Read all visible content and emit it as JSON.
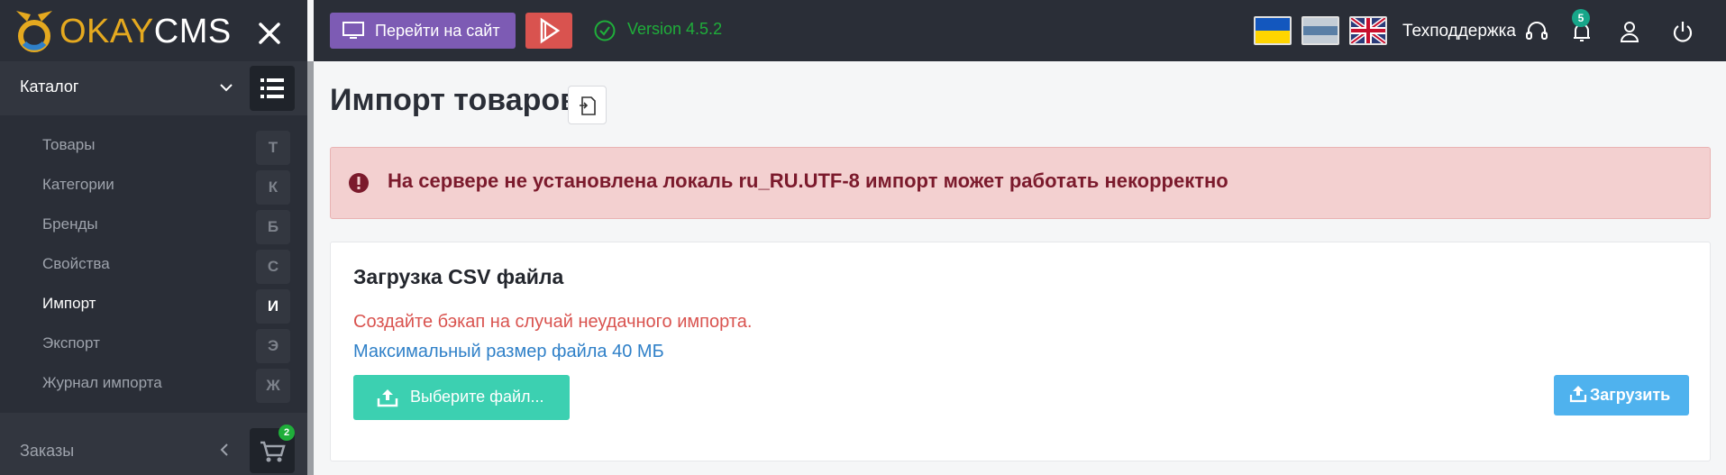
{
  "brand": {
    "name_part1": "OKAY",
    "name_part2": "CMS"
  },
  "sidebar": {
    "section_title": "Каталог",
    "items": [
      {
        "label": "Товары",
        "letter": "Т",
        "active": false
      },
      {
        "label": "Категории",
        "letter": "К",
        "active": false
      },
      {
        "label": "Бренды",
        "letter": "Б",
        "active": false
      },
      {
        "label": "Свойства",
        "letter": "С",
        "active": false
      },
      {
        "label": "Импорт",
        "letter": "И",
        "active": true
      },
      {
        "label": "Экспорт",
        "letter": "Э",
        "active": false
      },
      {
        "label": "Журнал импорта",
        "letter": "Ж",
        "active": false
      }
    ],
    "orders": {
      "label": "Заказы",
      "badge": "2"
    }
  },
  "topbar": {
    "goto_site_label": "Перейти на сайт",
    "version": "Version 4.5.2",
    "support_label": "Техподдержка",
    "notifications_count": "5",
    "flags": [
      "ua-flag",
      "ru-flag",
      "uk-flag"
    ]
  },
  "main": {
    "page_title": "Импорт товаров",
    "alert_text": "На сервере не установлена локаль ru_RU.UTF-8 импорт может работать некорректно",
    "card": {
      "title": "Загрузка CSV файла",
      "warning": "Создайте бэкап на случай неудачного импорта.",
      "info": "Максимальный размер файла 40 МБ",
      "choose_label": "Выберите файл...",
      "upload_label": "Загрузить"
    }
  },
  "colors": {
    "sidebar_bg": "#2a2e37",
    "brand_accent": "#e5a91f",
    "site_button": "#7d5bb4",
    "play_button": "#d9534f",
    "version_green": "#1fae3a",
    "alert_bg": "#f3d0d0",
    "alert_text": "#7b1a2c",
    "choose_button": "#3cd0b1",
    "upload_button": "#4fb2ee"
  }
}
